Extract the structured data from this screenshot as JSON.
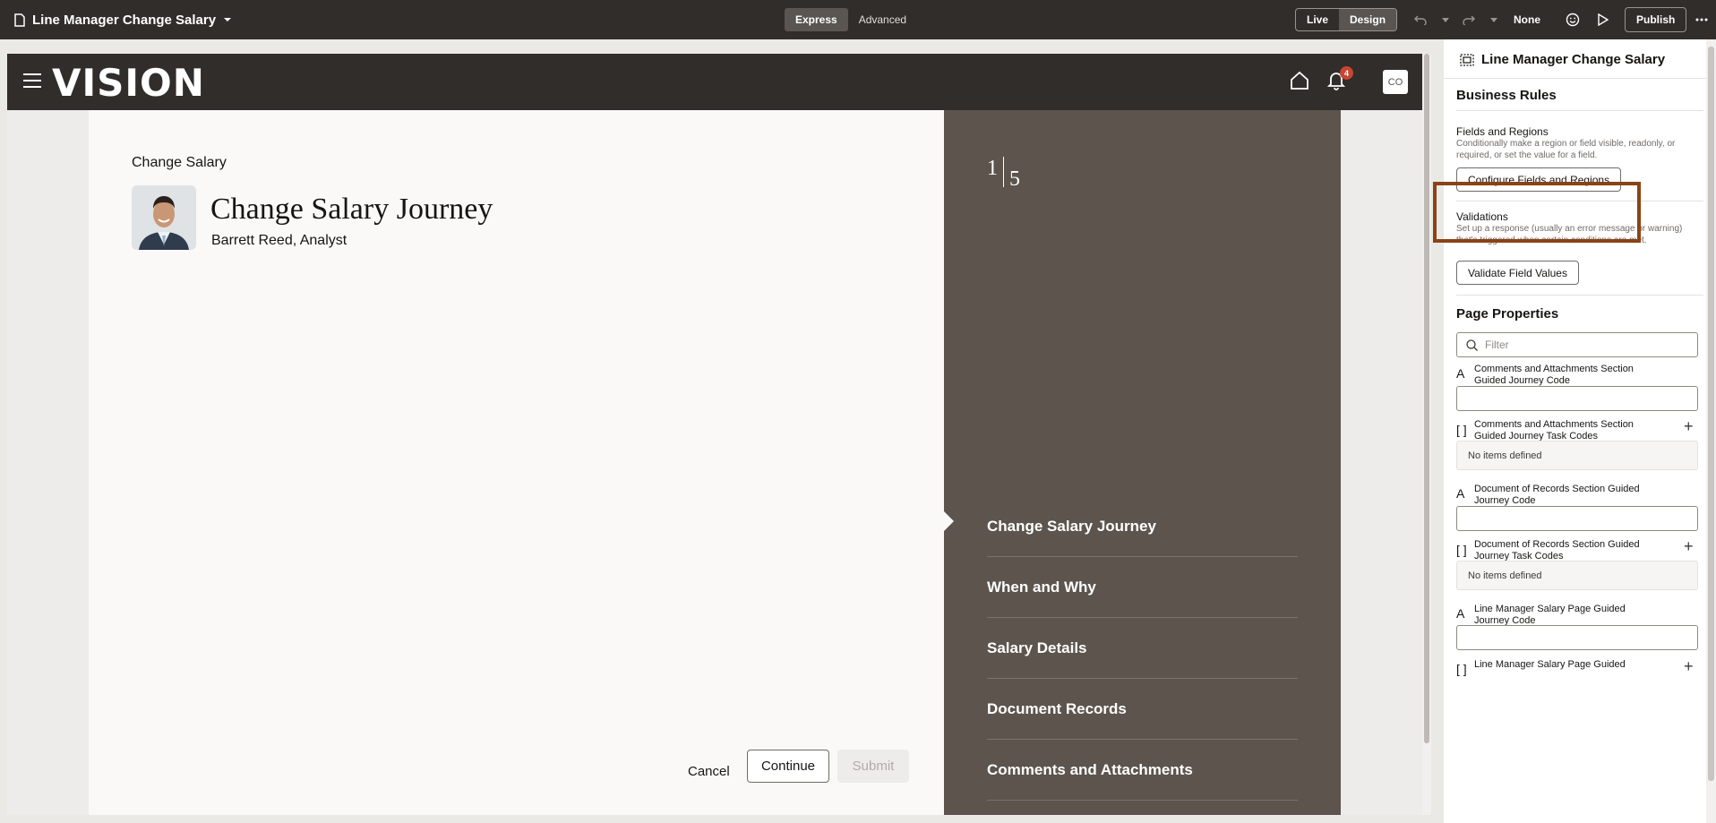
{
  "topbar": {
    "page_title": "Line Manager Change Salary",
    "mode_express": "Express",
    "mode_advanced": "Advanced",
    "view_live": "Live",
    "view_design": "Design",
    "sandbox": "None",
    "publish": "Publish"
  },
  "app": {
    "logo": "VISION",
    "notification_count": "4",
    "user_initials": "CO"
  },
  "page": {
    "breadcrumb": "Change Salary",
    "title": "Change Salary Journey",
    "person": "Barrett Reed, Analyst",
    "cancel": "Cancel",
    "continue": "Continue",
    "submit": "Submit"
  },
  "stepper": {
    "current": "1",
    "total": "5",
    "steps": [
      "Change Salary Journey",
      "When and Why",
      "Salary Details",
      "Document Records",
      "Comments and Attachments"
    ]
  },
  "panel": {
    "title": "Line Manager Change Salary",
    "business_rules": "Business Rules",
    "fields_regions_label": "Fields and Regions",
    "fields_regions_help": "Conditionally make a region or field visible, readonly, or required, or set the value for a field.",
    "configure_button": "Configure Fields and Regions",
    "validations_label": "Validations",
    "validations_help": "Set up a response (usually an error message or warning) that's triggered when certain conditions are met.",
    "validate_button": "Validate Field Values",
    "page_properties": "Page Properties",
    "filter_placeholder": "Filter",
    "properties": [
      {
        "label": "Comments and Attachments Section Guided Journey Code",
        "type": "text"
      },
      {
        "label": "Comments and Attachments Section Guided Journey Task Codes",
        "type": "list",
        "empty": "No items defined"
      },
      {
        "label": "Document of Records Section Guided Journey Code",
        "type": "text"
      },
      {
        "label": "Document of Records Section Guided Journey Task Codes",
        "type": "list",
        "empty": "No items defined"
      },
      {
        "label": "Line Manager Salary Page Guided Journey Code",
        "type": "text"
      },
      {
        "label": "Line Manager Salary Page Guided",
        "type": "list"
      }
    ]
  },
  "colors": {
    "topbar": "#312d2a",
    "stepper_bg": "#5c544d",
    "highlight": "#8a4316",
    "badge": "#c74634"
  }
}
